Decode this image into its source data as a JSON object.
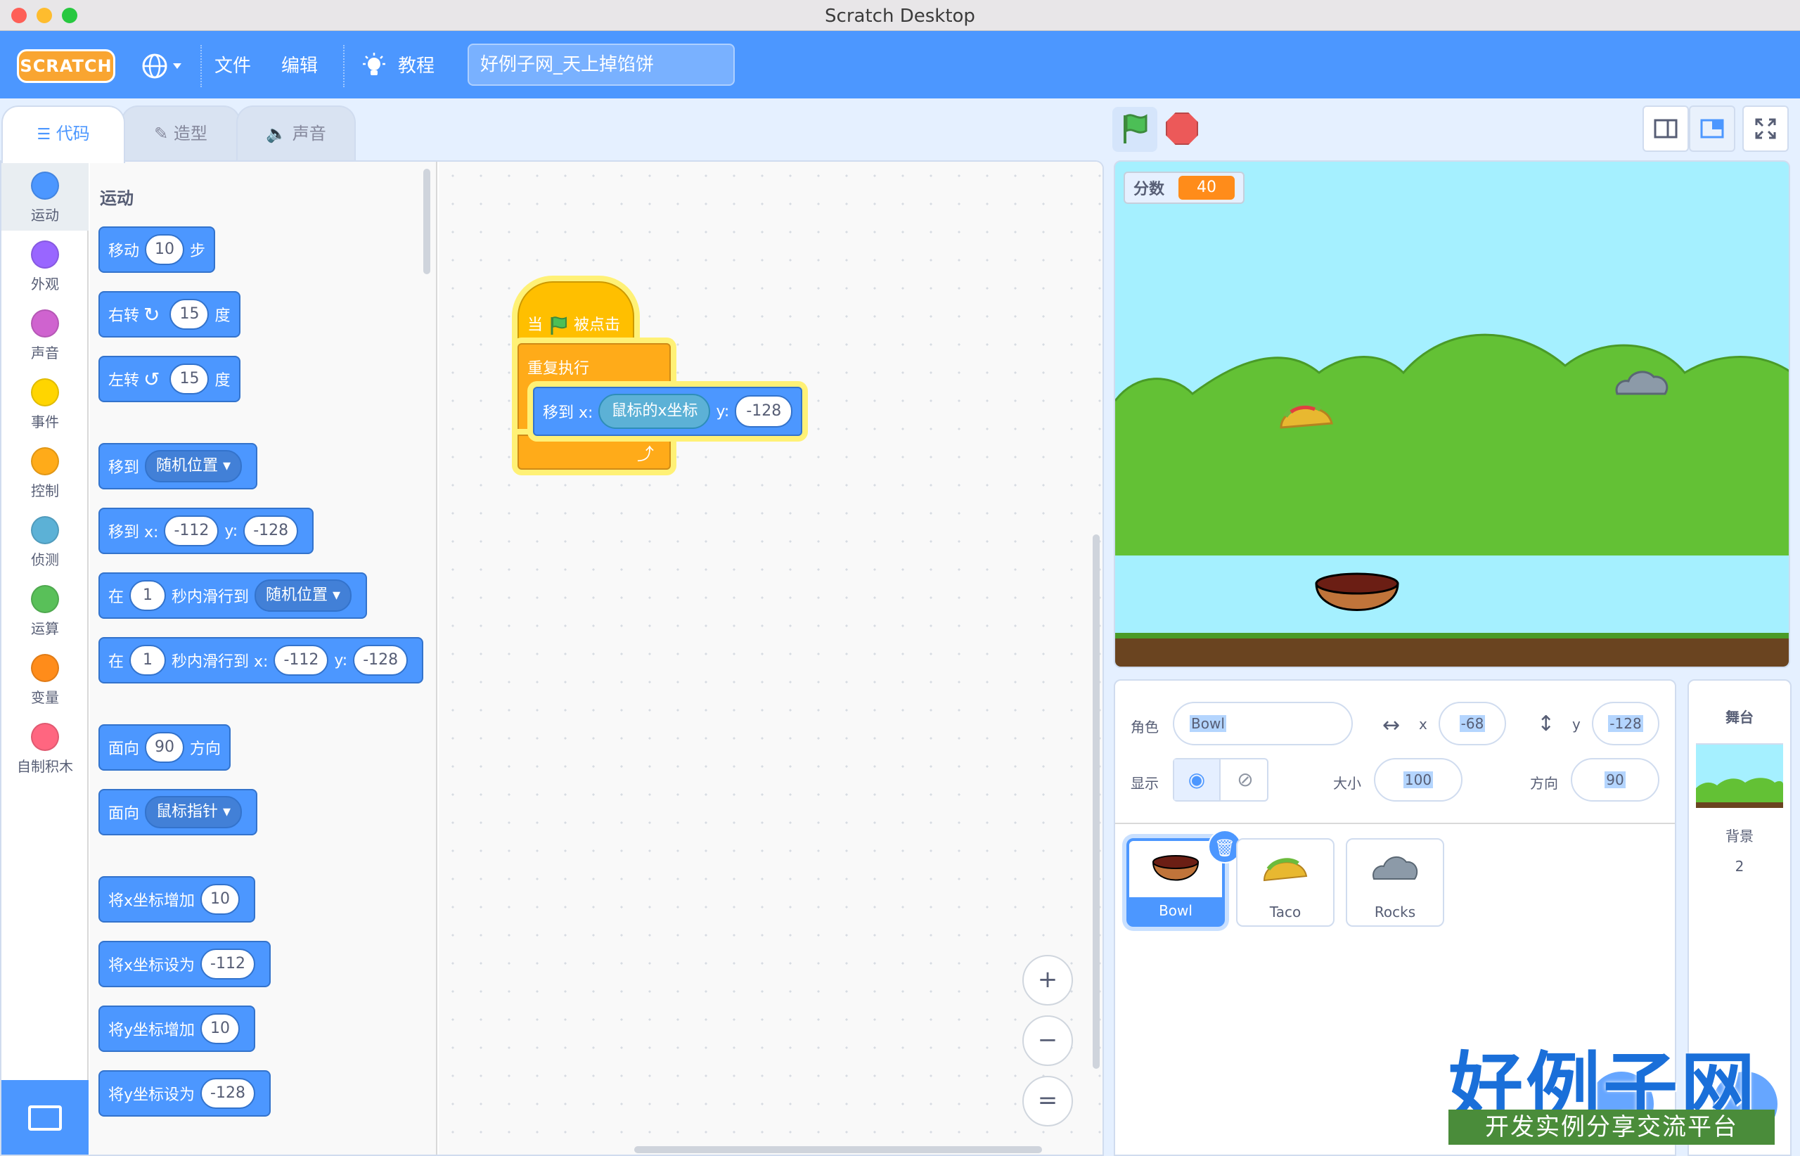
{
  "window": {
    "title": "Scratch Desktop"
  },
  "menubar": {
    "logo": "SCRATCH",
    "file": "文件",
    "edit": "编辑",
    "tutorials": "教程",
    "project_title": "好例子网_天上掉馅饼"
  },
  "tabs": {
    "code": "代码",
    "costumes": "造型",
    "sounds": "声音"
  },
  "categories": [
    {
      "label": "运动",
      "color": "#4c97ff"
    },
    {
      "label": "外观",
      "color": "#9966ff"
    },
    {
      "label": "声音",
      "color": "#cf63cf"
    },
    {
      "label": "事件",
      "color": "#ffd500"
    },
    {
      "label": "控制",
      "color": "#ffab19"
    },
    {
      "label": "侦测",
      "color": "#5cb1d6"
    },
    {
      "label": "运算",
      "color": "#59c059"
    },
    {
      "label": "变量",
      "color": "#ff8c1a"
    },
    {
      "label": "自制积木",
      "color": "#ff6680"
    }
  ],
  "palette": {
    "section": "运动",
    "move": {
      "a": "移动",
      "n": "10",
      "b": "步"
    },
    "turn_right": {
      "a": "右转",
      "icon": "↻",
      "n": "15",
      "b": "度"
    },
    "turn_left": {
      "a": "左转",
      "icon": "↺",
      "n": "15",
      "b": "度"
    },
    "goto": {
      "a": "移到",
      "dd": "随机位置 ▾"
    },
    "goto_xy": {
      "a": "移到 x:",
      "x": "-112",
      "b": "y:",
      "y": "-128"
    },
    "glide": {
      "a": "在",
      "n": "1",
      "b": "秒内滑行到",
      "dd": "随机位置 ▾"
    },
    "glide_xy": {
      "a": "在",
      "n": "1",
      "b": "秒内滑行到 x:",
      "x": "-112",
      "c": "y:",
      "y": "-128"
    },
    "point_dir": {
      "a": "面向",
      "n": "90",
      "b": "方向"
    },
    "point_towards": {
      "a": "面向",
      "dd": "鼠标指针 ▾"
    },
    "change_x": {
      "a": "将x坐标增加",
      "n": "10"
    },
    "set_x": {
      "a": "将x坐标设为",
      "n": "-112"
    },
    "change_y": {
      "a": "将y坐标增加",
      "n": "10"
    },
    "set_y": {
      "a": "将y坐标设为",
      "n": "-128"
    }
  },
  "script": {
    "hat_a": "当",
    "hat_b": "被点击",
    "forever": "重复执行",
    "goto_a": "移到 x:",
    "reporter": "鼠标的x坐标",
    "goto_b": "y:",
    "y": "-128",
    "loop_arrow": "⤴"
  },
  "zoom": {
    "in": "+",
    "out": "−",
    "reset": "="
  },
  "stage": {
    "monitor_label": "分数",
    "monitor_value": "40"
  },
  "sprite_info": {
    "sprite_label": "角色",
    "sprite_name": "Bowl",
    "x_label": "x",
    "x": "-68",
    "y_label": "y",
    "y": "-128",
    "show_label": "显示",
    "size_label": "大小",
    "size": "100",
    "dir_label": "方向",
    "direction": "90"
  },
  "sprites": [
    {
      "name": "Bowl"
    },
    {
      "name": "Taco"
    },
    {
      "name": "Rocks"
    }
  ],
  "stage_pane": {
    "title": "舞台",
    "backdrop_label": "背景",
    "backdrop_count": "2"
  },
  "watermark": {
    "title": "好例子网",
    "subtitle": "开发实例分享交流平台"
  },
  "colors": {
    "motion": "#4c97ff",
    "events": "#ffbf00",
    "control": "#ffab19",
    "sensing": "#5cb1d6",
    "variables": "#ff8c1a",
    "menubar": "#4c97ff"
  }
}
